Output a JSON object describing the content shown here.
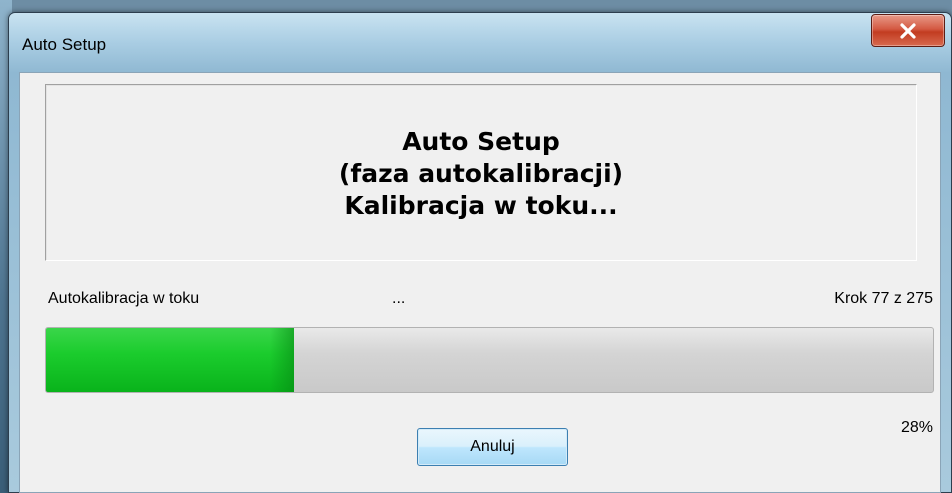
{
  "window": {
    "title": "Auto Setup",
    "close_icon": "close-x-icon"
  },
  "header": {
    "line1": "Auto Setup",
    "line2": "(faza autokalibracji)",
    "line3": "Kalibracja w toku..."
  },
  "status": {
    "label": "Autokalibracja w toku",
    "dots": "...",
    "step": "Krok 77 z 275"
  },
  "progress": {
    "fraction": 0.28,
    "percent_label": "28%",
    "fill_color": "#1bcc2d"
  },
  "buttons": {
    "cancel_label": "Anuluj"
  }
}
